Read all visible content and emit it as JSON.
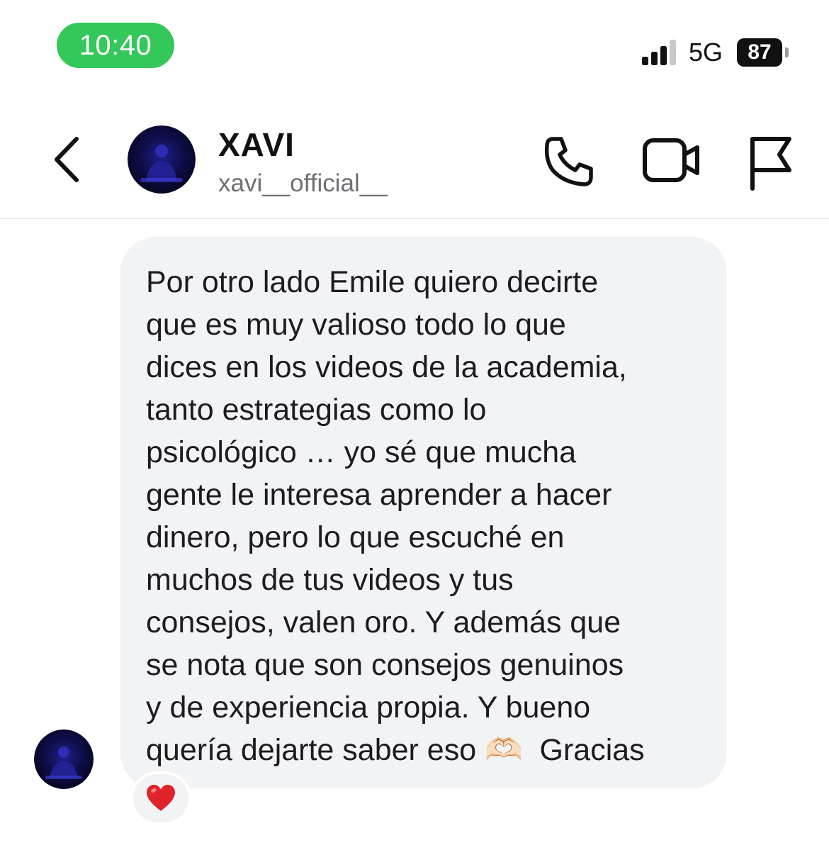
{
  "status_bar": {
    "time": "10:40",
    "network": "5G",
    "battery": "87",
    "colors": {
      "time_pill": "#34c759"
    },
    "icons": [
      "signal-icon",
      "battery-icon"
    ]
  },
  "header": {
    "contact_name": "XAVI",
    "username": "xavi__official__",
    "icons": [
      "back-icon",
      "avatar",
      "phone-icon",
      "video-camera-icon",
      "flag-icon"
    ]
  },
  "message": {
    "text_lines": [
      "Por otro lado Emile quiero decirte",
      "que es muy valioso todo lo que",
      "dices en los videos de la academia,",
      "tanto estrategias como lo",
      "psicológico … yo sé que mucha",
      "gente le interesa aprender a hacer",
      "dinero, pero lo que escuché en",
      "muchos de tus videos y tus",
      "consejos, valen oro. Y además que",
      "se nota que son consejos genuinos",
      "y de experiencia propia. Y bueno",
      "quería dejarte saber eso 🫶🏻  Gracias"
    ],
    "reaction": "heart-icon",
    "colors": {
      "bubble": "#f2f3f5",
      "reaction_heart": "#e0242c"
    }
  }
}
